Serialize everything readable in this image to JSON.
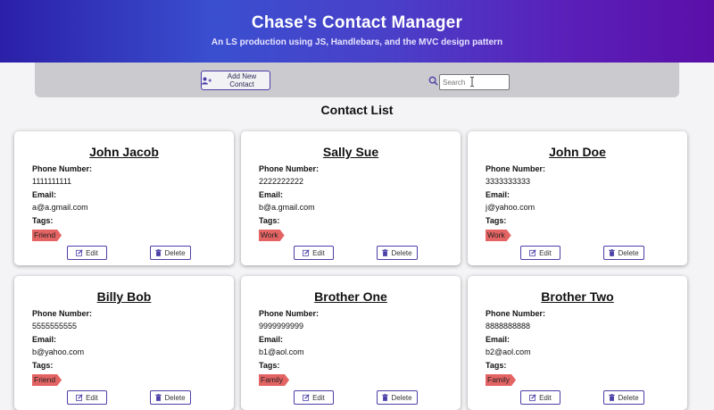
{
  "header": {
    "title": "Chase's Contact Manager",
    "subtitle": "An LS production using JS, Handlebars, and the MVC design pattern"
  },
  "toolbar": {
    "add_label": "Add New Contact",
    "search_placeholder": "Search"
  },
  "list_title": "Contact List",
  "labels": {
    "phone": "Phone Number:",
    "email": "Email:",
    "tags": "Tags:"
  },
  "actions": {
    "edit": "Edit",
    "delete": "Delete"
  },
  "contacts": [
    {
      "name": "John Jacob",
      "phone": "1111111111",
      "email": "a@a.gmail.com",
      "tag": "Friend"
    },
    {
      "name": "Sally Sue",
      "phone": "2222222222",
      "email": "b@a.gmail.com",
      "tag": "Work"
    },
    {
      "name": "John Doe",
      "phone": "3333333333",
      "email": "j@yahoo.com",
      "tag": "Work"
    },
    {
      "name": "Billy Bob",
      "phone": "5555555555",
      "email": "b@yahoo.com",
      "tag": "Friend"
    },
    {
      "name": "Brother One",
      "phone": "9999999999",
      "email": "b1@aol.com",
      "tag": "Family"
    },
    {
      "name": "Brother Two",
      "phone": "8888888888",
      "email": "b2@aol.com",
      "tag": "Family"
    }
  ],
  "colors": {
    "accent": "#4b3fa8",
    "tag": "#e46464",
    "toolbar": "#cbcbcf"
  }
}
